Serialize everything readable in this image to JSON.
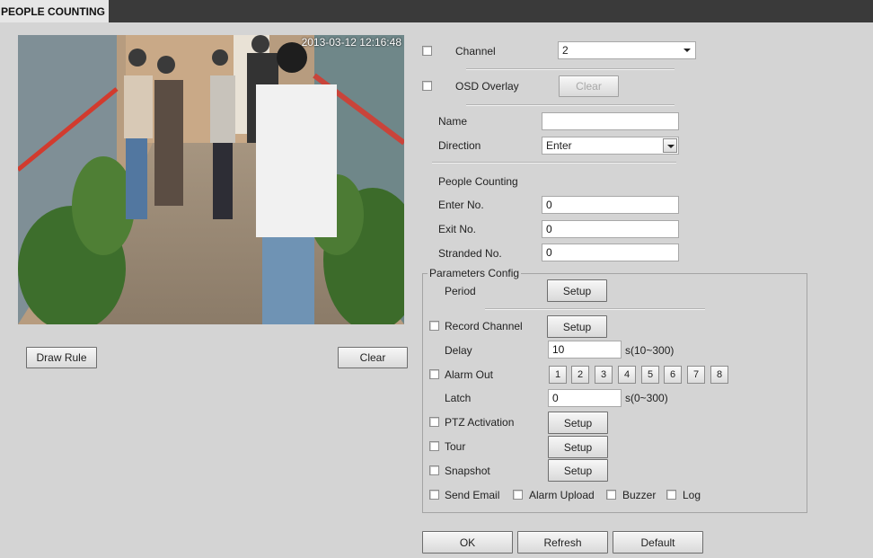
{
  "window": {
    "title": "PEOPLE COUNTING"
  },
  "video": {
    "timestamp": "2013-03-12 12:16:48"
  },
  "buttons": {
    "draw_rule": "Draw Rule",
    "clear_rule": "Clear",
    "osd_clear": "Clear",
    "period_setup": "Setup",
    "record_setup": "Setup",
    "ptz_setup": "Setup",
    "tour_setup": "Setup",
    "snapshot_setup": "Setup",
    "ok": "OK",
    "refresh": "Refresh",
    "default": "Default"
  },
  "form": {
    "channel": {
      "label": "Channel",
      "value": "2",
      "checked": false
    },
    "osd_overlay": {
      "label": "OSD Overlay",
      "checked": false
    },
    "name": {
      "label": "Name",
      "value": ""
    },
    "direction": {
      "label": "Direction",
      "value": "Enter"
    },
    "people_counting": {
      "label": "People Counting",
      "enter": {
        "label": "Enter No.",
        "value": "0"
      },
      "exit": {
        "label": "Exit No.",
        "value": "0"
      },
      "stranded": {
        "label": "Stranded No.",
        "value": "0"
      }
    }
  },
  "params": {
    "legend": "Parameters Config",
    "period_label": "Period",
    "record_channel_label": "Record Channel",
    "delay": {
      "label": "Delay",
      "value": "10",
      "range": "s(10~300)"
    },
    "alarm_out": {
      "label": "Alarm Out",
      "outputs": [
        "1",
        "2",
        "3",
        "4",
        "5",
        "6",
        "7",
        "8"
      ]
    },
    "latch": {
      "label": "Latch",
      "value": "0",
      "range": "s(0~300)"
    },
    "ptz_label": "PTZ Activation",
    "tour_label": "Tour",
    "snapshot_label": "Snapshot",
    "send_email_label": "Send Email",
    "alarm_upload_label": "Alarm Upload",
    "buzzer_label": "Buzzer",
    "log_label": "Log"
  }
}
